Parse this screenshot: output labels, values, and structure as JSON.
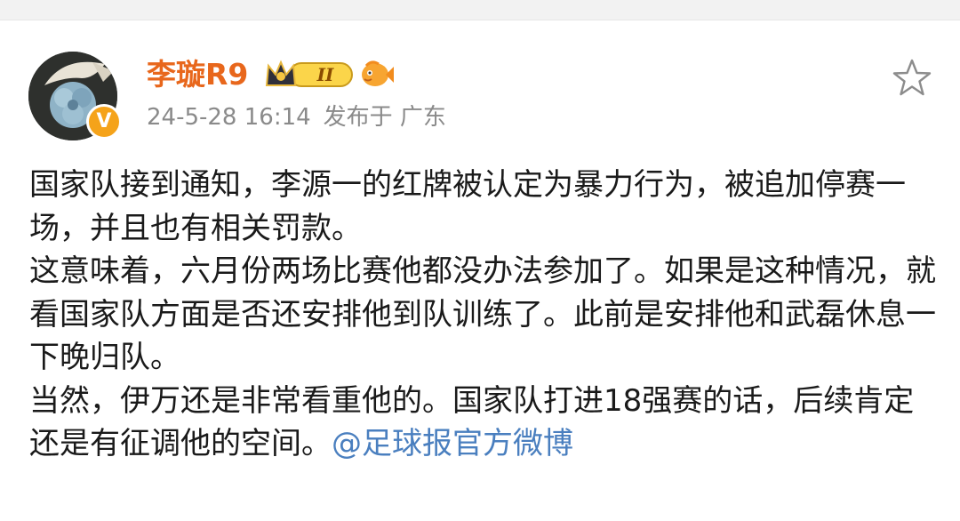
{
  "post": {
    "username": "李璇R9",
    "level": "II",
    "timestamp": "24-5-28 16:14",
    "location": "发布于 广东",
    "paragraphs": [
      "国家队接到通知，李源一的红牌被认定为暴力行为，被追加停赛一场，并且也有相关罚款。",
      "这意味着，六月份两场比赛他都没办法参加了。如果是这种情况，就看国家队方面是否还安排他到队训练了。此前是安排他和武磊休息一下晚归队。",
      "当然，伊万还是非常看重他的。国家队打进18强赛的话，后续肯定还是有征调他的空间。"
    ],
    "mention": "@足球报官方微博"
  },
  "icons": {
    "verified": "verified-v-badge",
    "vip": "crown-vip-badge",
    "fan": "fish-icon",
    "favorite": "star-icon"
  },
  "colors": {
    "username": "#e8671c",
    "mention": "#4a7fbf",
    "meta": "#8a8a8a",
    "verified": "#f5a31a"
  }
}
